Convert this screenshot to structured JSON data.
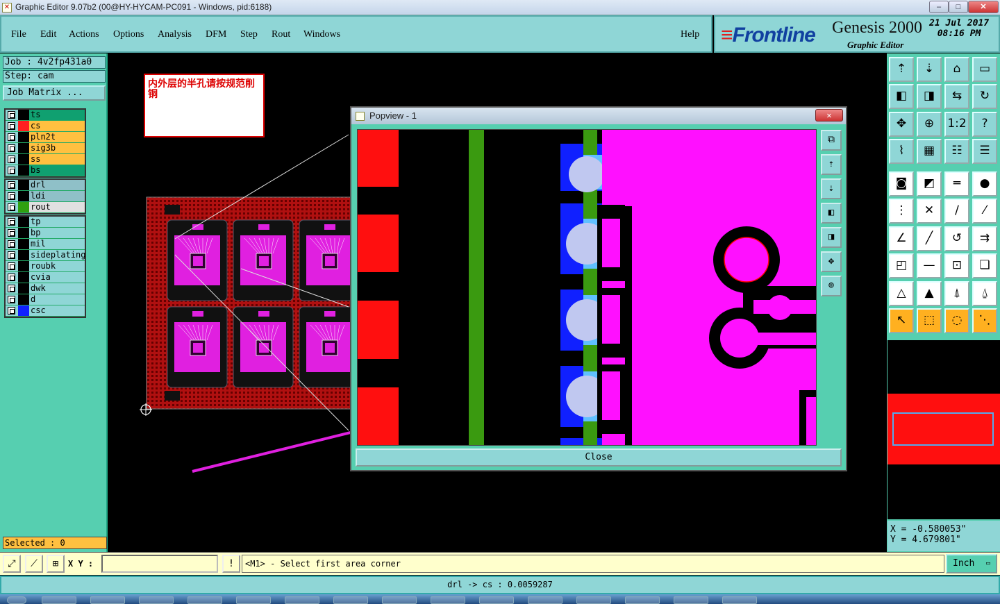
{
  "window": {
    "title": "Graphic Editor 9.07b2 (00@HY-HYCAM-PC091 - Windows, pid:6188)",
    "min_label": "–",
    "max_label": "□",
    "close_label": "✕"
  },
  "menubar": {
    "items": [
      "File",
      "Edit",
      "Actions",
      "Options",
      "Analysis",
      "DFM",
      "Step",
      "Rout",
      "Windows"
    ],
    "help": "Help"
  },
  "branding": {
    "logo_prefix": "≡",
    "logo": "Frontline",
    "product": "Genesis 2000",
    "subtitle": "Graphic Editor",
    "date": "21 Jul 2017",
    "time": "08:16 PM"
  },
  "job": {
    "job_label": "Job : 4v2fp431a0",
    "step_label": "Step: cam",
    "matrix_button": "Job Matrix ..."
  },
  "layers": {
    "group1": [
      {
        "name": "ts",
        "color": "#10a070",
        "swatch": "#000000"
      },
      {
        "name": "cs",
        "color": "#ffc040",
        "swatch": "#ff2020"
      },
      {
        "name": "pln2t",
        "color": "#ffc040",
        "swatch": "#000000"
      },
      {
        "name": "sig3b",
        "color": "#ffc040",
        "swatch": "#000000"
      },
      {
        "name": "ss",
        "color": "#ffc040",
        "swatch": "#000000"
      },
      {
        "name": "bs",
        "color": "#10a070",
        "swatch": "#000000"
      }
    ],
    "group2": [
      {
        "name": "drl",
        "color": "#8fc0c8",
        "swatch": "#000000"
      },
      {
        "name": "ldi",
        "color": "#8fc0c8",
        "swatch": "#000000"
      },
      {
        "name": "rout",
        "color": "#e0e0e0",
        "swatch": "#30a010"
      }
    ],
    "group3": [
      {
        "name": "tp",
        "color": "#8fd6d6",
        "swatch": "#000000"
      },
      {
        "name": "bp",
        "color": "#8fd6d6",
        "swatch": "#000000"
      },
      {
        "name": "mil",
        "color": "#8fd6d6",
        "swatch": "#000000"
      },
      {
        "name": "sideplating",
        "color": "#8fd6d6",
        "swatch": "#000000"
      },
      {
        "name": "roubk",
        "color": "#8fd6d6",
        "swatch": "#000000"
      },
      {
        "name": "cvia",
        "color": "#8fd6d6",
        "swatch": "#000000"
      },
      {
        "name": "dwk",
        "color": "#8fd6d6",
        "swatch": "#000000"
      },
      {
        "name": "d",
        "color": "#8fd6d6",
        "swatch": "#000000"
      },
      {
        "name": "csc",
        "color": "#8fd6d6",
        "swatch": "#1020ff"
      }
    ]
  },
  "selected": "Selected : 0",
  "note": {
    "text": "内外层的半孔请按规范削铜"
  },
  "popview": {
    "title": "Popview - 1",
    "close_x": "✕",
    "close_button": "Close",
    "side_buttons": [
      "fit-icon",
      "pan-up-icon",
      "pan-down-icon",
      "pan-left-icon",
      "pan-right-icon",
      "zoom-out-icon",
      "zoom-in-icon"
    ]
  },
  "toolbox": {
    "buttons": [
      [
        "move-up-icon",
        "move-down-icon",
        "home-icon",
        "window-icon"
      ],
      [
        "pan-left-icon",
        "pan-right-icon",
        "mirror-icon",
        "redraw-icon"
      ],
      [
        "fit-screen-icon",
        "zoom-center-icon",
        "scale-1to2-icon",
        "help-icon"
      ],
      [
        "snap-icon",
        "grid-icon",
        "layers-icon",
        "layers-alt-icon"
      ],
      [
        "pad-icon",
        "shape-icon",
        "ruler-icon",
        "circle-icon"
      ],
      [
        "connect-icon",
        "cross-icon",
        "line-node-icon",
        "line-node-alt-icon"
      ],
      [
        "angle-icon",
        "diagonal-icon",
        "arc-icon",
        "split-icon"
      ],
      [
        "box-node-icon",
        "dash-icon",
        "frame-icon",
        "shapes-icon"
      ],
      [
        "triangle-icon",
        "triangle-up-icon",
        "triangle-a-icon",
        "triangle-b-icon"
      ],
      [
        "select-icon",
        "select-box-icon",
        "select-circle-icon",
        "select-net-icon"
      ]
    ],
    "glyphs": {
      "move-up-icon": "⇡",
      "move-down-icon": "⇣",
      "home-icon": "⌂",
      "window-icon": "▭",
      "pan-left-icon": "◧",
      "pan-right-icon": "◨",
      "mirror-icon": "⇆",
      "redraw-icon": "↻",
      "fit-screen-icon": "✥",
      "zoom-center-icon": "⊕",
      "scale-1to2-icon": "1:2",
      "help-icon": "?",
      "snap-icon": "⌇",
      "grid-icon": "▦",
      "layers-icon": "☷",
      "layers-alt-icon": "☰",
      "pad-icon": "◙",
      "shape-icon": "◩",
      "ruler-icon": "═",
      "circle-icon": "●",
      "connect-icon": "⋮",
      "cross-icon": "✕",
      "line-node-icon": "∕",
      "line-node-alt-icon": "⁄",
      "angle-icon": "∠",
      "diagonal-icon": "╱",
      "arc-icon": "↺",
      "split-icon": "⇉",
      "box-node-icon": "◰",
      "dash-icon": "—",
      "frame-icon": "⊡",
      "shapes-icon": "❏",
      "triangle-icon": "△",
      "triangle-up-icon": "▲",
      "triangle-a-icon": "⍋",
      "triangle-b-icon": "⍙",
      "select-icon": "↖",
      "select-box-icon": "⬚",
      "select-circle-icon": "◌",
      "select-net-icon": "⋱"
    }
  },
  "coords": {
    "x": "X = -0.580053\"",
    "y": "Y = 4.679801\""
  },
  "bottom": {
    "xy_label": "X Y :",
    "xy_value": "",
    "warn": "!",
    "prompt": "<M1> - Select first area corner",
    "unit": "Inch",
    "unit_arrow": "▭"
  },
  "status": "drl -> cs : 0.0059287"
}
